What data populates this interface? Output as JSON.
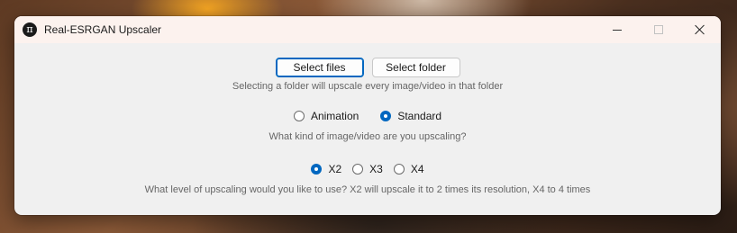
{
  "window": {
    "title": "Real-ESRGAN Upscaler",
    "icon": "pi-icon"
  },
  "file_selection": {
    "select_files_label": "Select files",
    "select_folder_label": "Select folder",
    "hint": "Selecting a folder will upscale every image/video in that folder"
  },
  "content_type": {
    "options": [
      "Animation",
      "Standard"
    ],
    "selected": "Standard",
    "hint": "What kind of image/video are you upscaling?"
  },
  "scale": {
    "options": [
      "X2",
      "X3",
      "X4"
    ],
    "selected": "X2",
    "hint": "What level of upscaling would you like to use? X2 will upscale it to 2 times its resolution, X4 to 4 times"
  },
  "colors": {
    "accent": "#0067c0",
    "titlebar": "#fcf2ee",
    "window_bg": "#f0f0f0"
  }
}
